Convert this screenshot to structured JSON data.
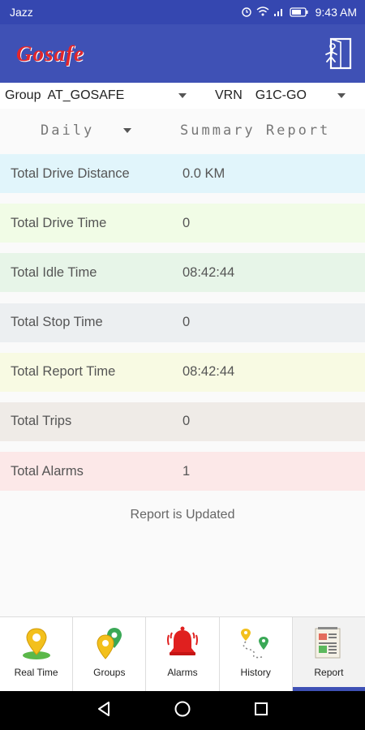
{
  "status_bar": {
    "carrier": "Jazz",
    "time": "9:43 AM",
    "icons": [
      "alarm-icon",
      "wifi-icon",
      "signal-icon",
      "battery-icon"
    ]
  },
  "app_bar": {
    "logo": "Gosafe",
    "exit_icon": "exit-door-icon",
    "background": "#3f51b5",
    "logo_color": "#e2262c"
  },
  "filters": {
    "group_label": "Group",
    "group_value": "AT_GOSAFE",
    "vrn_label": "VRN",
    "vrn_value": "G1C-GO"
  },
  "report_header": {
    "period": "Daily",
    "title": "Summary Report"
  },
  "summary": [
    {
      "label": "Total Drive Distance",
      "value": "0.0 KM",
      "color": "#e1f5fb"
    },
    {
      "label": "Total Drive Time",
      "value": "0",
      "color": "#f1fce6"
    },
    {
      "label": "Total Idle Time",
      "value": "08:42:44",
      "color": "#e7f5e8"
    },
    {
      "label": "Total Stop Time",
      "value": "0",
      "color": "#eceff1"
    },
    {
      "label": "Total Report Time",
      "value": "08:42:44",
      "color": "#f8fae3"
    },
    {
      "label": "Total Trips",
      "value": "0",
      "color": "#efebe7"
    },
    {
      "label": "Total Alarms",
      "value": "1",
      "color": "#fce8e8"
    }
  ],
  "status_message": "Report is Updated",
  "bottom_nav": [
    {
      "label": "Real Time",
      "icon": "map-pin-icon"
    },
    {
      "label": "Groups",
      "icon": "group-pins-icon"
    },
    {
      "label": "Alarms",
      "icon": "alarm-bell-icon"
    },
    {
      "label": "History",
      "icon": "route-history-icon"
    },
    {
      "label": "Report",
      "icon": "report-document-icon",
      "active": true
    }
  ],
  "accent": "#3f51b5"
}
